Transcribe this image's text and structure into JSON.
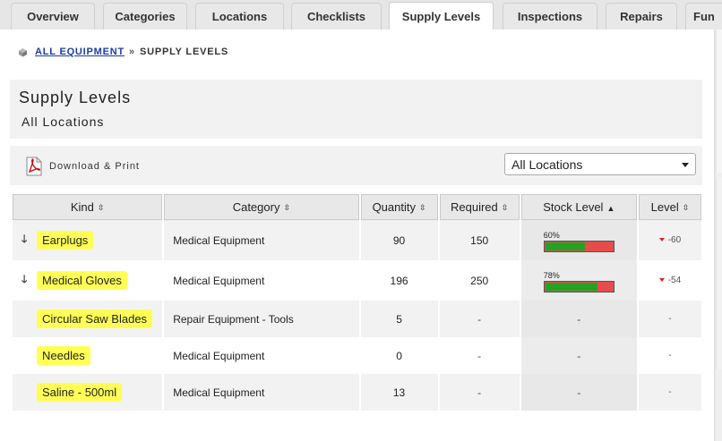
{
  "tabs": [
    "Overview",
    "Categories",
    "Locations",
    "Checklists",
    "Supply Levels",
    "Inspections",
    "Repairs",
    "Fun"
  ],
  "active_tab": "Supply Levels",
  "breadcrumb": {
    "link": "ALL EQUIPMENT",
    "separator": "»",
    "current": "SUPPLY LEVELS"
  },
  "header": {
    "title": "Supply Levels",
    "subtitle": "All Locations"
  },
  "toolbar": {
    "download_label": "Download & Print",
    "location_select": "All Locations"
  },
  "table": {
    "columns": [
      "Kind",
      "Category",
      "Quantity",
      "Required",
      "Stock Level",
      "Level"
    ],
    "rows": [
      {
        "kind": "Earplugs",
        "category": "Medical Equipment",
        "quantity": "90",
        "required": "150",
        "stock_pct": 60,
        "stock_label": "60%",
        "level": "-60",
        "low": true
      },
      {
        "kind": "Medical Gloves",
        "category": "Medical Equipment",
        "quantity": "196",
        "required": "250",
        "stock_pct": 78,
        "stock_label": "78%",
        "level": "-54",
        "low": true
      },
      {
        "kind": "Circular Saw Blades",
        "category": "Repair Equipment - Tools",
        "quantity": "5",
        "required": "-",
        "stock": "-",
        "level": "-",
        "low": false
      },
      {
        "kind": "Needles",
        "category": "Medical Equipment",
        "quantity": "0",
        "required": "-",
        "stock": "-",
        "level": "-",
        "low": false
      },
      {
        "kind": "Saline - 500ml",
        "category": "Medical Equipment",
        "quantity": "13",
        "required": "-",
        "stock": "-",
        "level": "-",
        "low": false
      }
    ]
  },
  "colors": {
    "highlight": "#ffff55",
    "stock_ok": "#23a323",
    "stock_low": "#e74c4c",
    "link": "#1a3da8"
  }
}
